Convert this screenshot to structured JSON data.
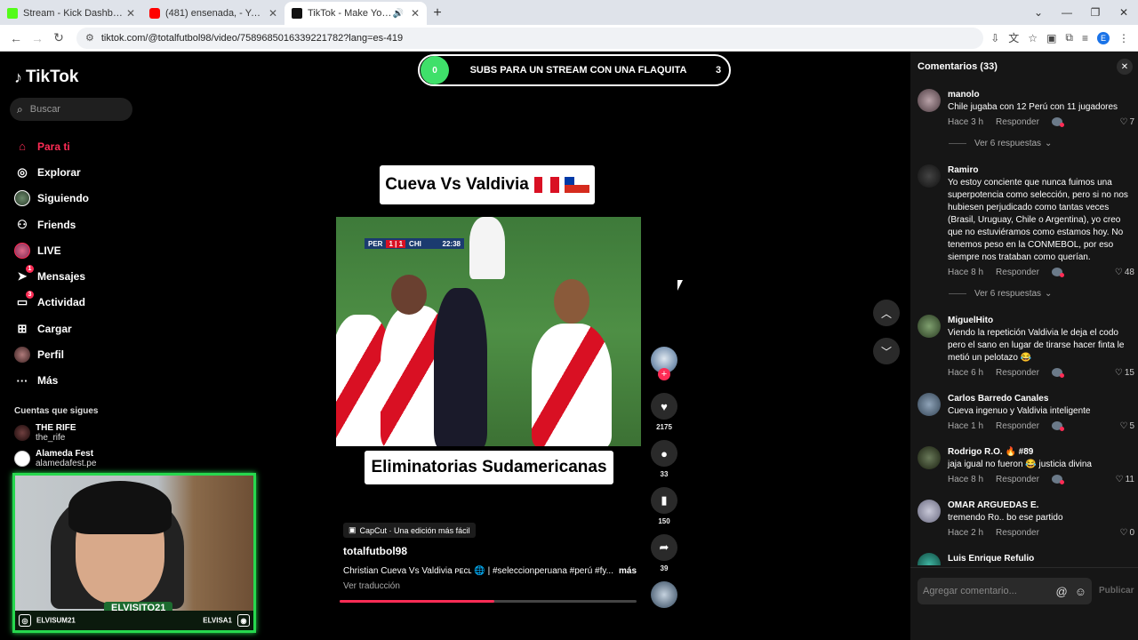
{
  "browser": {
    "tabs": [
      {
        "title": "Stream - Kick Dashboard",
        "favicon_color": "#53fc18",
        "active": false
      },
      {
        "title": "(481) ensenada, - YouTube",
        "favicon_color": "#ff0000",
        "active": false
      },
      {
        "title": "TikTok - Make Your Day",
        "favicon_color": "#111111",
        "active": true
      }
    ],
    "new_tab": "+",
    "url": "tiktok.com/@totalfutbol98/video/7589685016339221782?lang=es-419",
    "profile_initial": "E"
  },
  "sidebar": {
    "logo": "TikTok",
    "search_placeholder": "Buscar",
    "items": [
      {
        "label": "Para ti",
        "icon": "home-icon",
        "active": true
      },
      {
        "label": "Explorar",
        "icon": "compass-icon"
      },
      {
        "label": "Siguiendo",
        "icon": "following-avatar-icon"
      },
      {
        "label": "Friends",
        "icon": "friends-icon"
      },
      {
        "label": "LIVE",
        "icon": "live-icon"
      },
      {
        "label": "Mensajes",
        "icon": "messages-icon",
        "badge": "1"
      },
      {
        "label": "Actividad",
        "icon": "activity-icon",
        "badge": "3"
      },
      {
        "label": "Cargar",
        "icon": "upload-icon"
      },
      {
        "label": "Perfil",
        "icon": "profile-avatar-icon"
      },
      {
        "label": "Más",
        "icon": "more-icon"
      }
    ],
    "following_title": "Cuentas que sigues",
    "following": [
      {
        "name": "THE RIFE",
        "handle": "the_rife"
      },
      {
        "name": "Alameda Fest",
        "handle": "alamedafest.pe"
      }
    ]
  },
  "webcam": {
    "name": "ELVISITO21",
    "left_handle": "ELVISUM21",
    "right_handle": "ELVISA1"
  },
  "sub_goal": {
    "current": "0",
    "label": "SUBS PARA UN STREAM CON UNA FLAQUITA",
    "target": "3"
  },
  "video": {
    "top_caption": "Cueva Vs Valdivia",
    "bottom_caption": "Eliminatorias Sudamericanas",
    "scoreboard": {
      "home": "PER",
      "score": "1 | 1",
      "away": "CHI",
      "time": "22:38"
    },
    "capcut": "CapCut · Una edición más fácil",
    "author": "totalfutbol98",
    "description": "Christian Cueva Vs Valdivia ᴘᴇᴄʟ 🌐 | #seleccionperuana #perú #fy...",
    "more": "más",
    "translate": "Ver traducción",
    "progress": 0.52
  },
  "actions": {
    "likes": "2175",
    "comments": "33",
    "saves": "150",
    "shares": "39"
  },
  "comments_panel": {
    "title": "Comentarios (33)",
    "reply_label": "Responder",
    "view_replies": "Ver 6 respuestas",
    "input_placeholder": "Agregar comentario...",
    "publish": "Publicar",
    "comments": [
      {
        "user": "manolo",
        "text": "Chile jugaba con 12 Perú con 11 jugadores",
        "time": "Hace 3 h",
        "likes": "7"
      },
      {
        "user": "Ramiro",
        "text": "Yo estoy conciente que nunca fuimos una superpotencia como selección, pero si no nos hubiesen perjudicado como tantas veces (Brasil, Uruguay, Chile o Argentina), yo creo que no estuviéramos como estamos hoy. No tenemos peso en la CONMEBOL, por eso siempre nos trataban como querían.",
        "time": "Hace 8 h",
        "likes": "48"
      },
      {
        "user": "MiguelHito",
        "text": "Viendo la repetición Valdivia le deja el codo pero el sano en lugar de tirarse hacer finta le metió un pelotazo 😂",
        "time": "Hace 6 h",
        "likes": "15"
      },
      {
        "user": "Carlos Barredo Canales",
        "text": "Cueva ingenuo y Valdivia inteligente",
        "time": "Hace 1 h",
        "likes": "5"
      },
      {
        "user": "Rodrigo R.O. 🔥 #89",
        "text": "jaja igual no fueron 😂 justicia divina",
        "time": "Hace 8 h",
        "likes": "11"
      },
      {
        "user": "OMAR ARGUEDAS E.",
        "text": "tremendo Ro.. bo ese partido",
        "time": "Hace 2 h",
        "likes": "0"
      },
      {
        "user": "Luis Enrique Refulio",
        "text": "",
        "time": "",
        "likes": ""
      }
    ]
  }
}
